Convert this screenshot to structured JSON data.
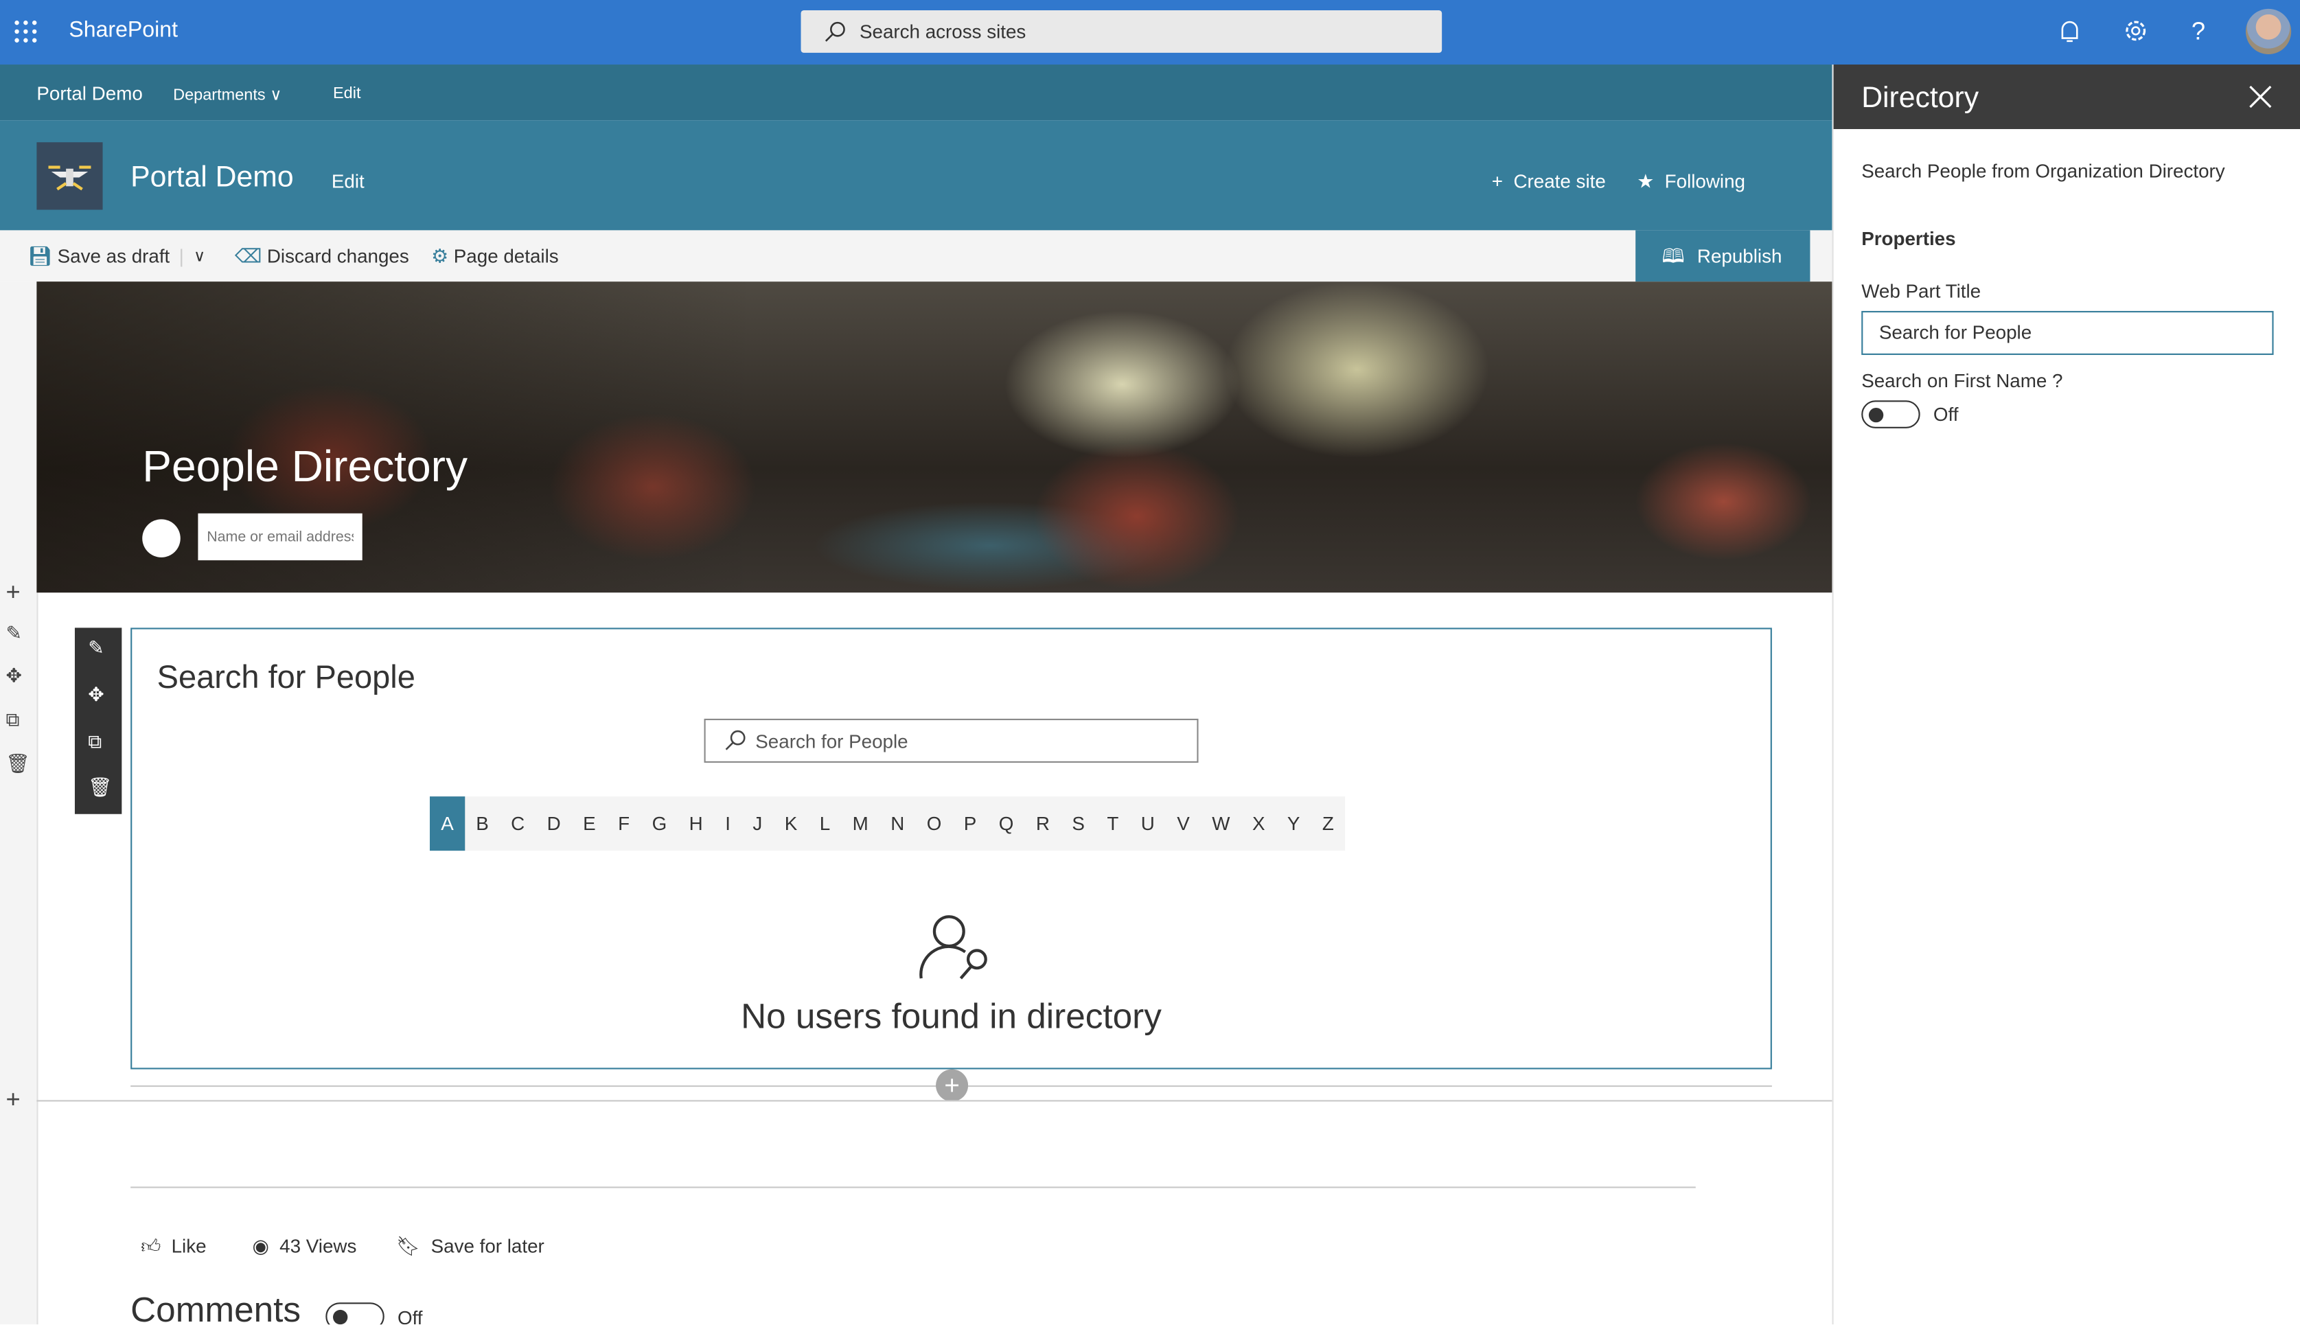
{
  "topbar": {
    "brand": "SharePoint",
    "search_placeholder": "Search across sites",
    "icons": [
      "waffle-icon",
      "search-icon",
      "bell-icon",
      "gear-icon",
      "help-icon",
      "avatar"
    ]
  },
  "nav": {
    "site": "Portal Demo",
    "departments": "Departments",
    "edit": "Edit"
  },
  "site_header": {
    "title": "Portal Demo",
    "edit": "Edit",
    "create_site": "Create site",
    "following": "Following"
  },
  "command_bar": {
    "save_draft": "Save as draft",
    "discard": "Discard changes",
    "page_details": "Page details",
    "republish": "Republish"
  },
  "hero": {
    "title": "People Directory",
    "search_placeholder": "Name or email address"
  },
  "webpart": {
    "title": "Search for People",
    "search_placeholder": "Search for People",
    "letters": [
      "A",
      "B",
      "C",
      "D",
      "E",
      "F",
      "G",
      "H",
      "I",
      "J",
      "K",
      "L",
      "M",
      "N",
      "O",
      "P",
      "Q",
      "R",
      "S",
      "T",
      "U",
      "V",
      "W",
      "X",
      "Y",
      "Z"
    ],
    "selected_letter": "A",
    "empty_message": "No users found in directory"
  },
  "footer": {
    "like": "Like",
    "views": "43 Views",
    "save_later": "Save for later",
    "comments": "Comments",
    "comments_toggle": "Off"
  },
  "panel": {
    "title": "Directory",
    "description": "Search People from Organization Directory",
    "properties": "Properties",
    "web_part_title_label": "Web Part Title",
    "web_part_title_value": "Search for People",
    "first_name_label": "Search on First Name ?",
    "first_name_toggle": "Off"
  },
  "colors": {
    "suite_bar": "#3178cd",
    "theme": "#377e9b",
    "nav": "#2f708a",
    "panel_header": "#3c3c3c"
  }
}
